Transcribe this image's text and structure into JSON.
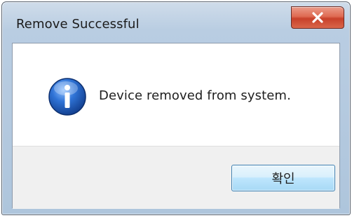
{
  "dialog": {
    "title": "Remove Successful",
    "message": "Device removed from system.",
    "ok_label": "확인",
    "close_icon": "close-x-icon",
    "info_icon": "info-icon"
  },
  "colors": {
    "close_button": "#d9553c",
    "ok_button_border": "#3c7fb1",
    "info_icon_blue": "#1f5fc4"
  }
}
